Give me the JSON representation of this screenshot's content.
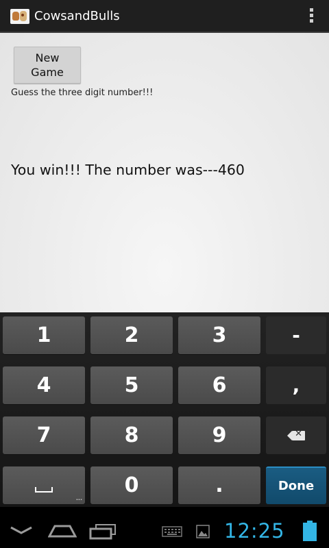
{
  "app": {
    "title": "CowsandBulls"
  },
  "main": {
    "new_game_label": "New\nGame",
    "instruction": "Guess the three digit number!!!",
    "result": "You win!!! The number was---460"
  },
  "keyboard": {
    "keys": [
      "1",
      "2",
      "3",
      "-",
      "4",
      "5",
      "6",
      ",",
      "7",
      "8",
      "9",
      "0",
      ".",
      "Done"
    ]
  },
  "status": {
    "time": "12:25"
  },
  "colors": {
    "accent": "#33b5e5",
    "done_key": "#114a6b",
    "action_bar": "#1f1f1f"
  }
}
